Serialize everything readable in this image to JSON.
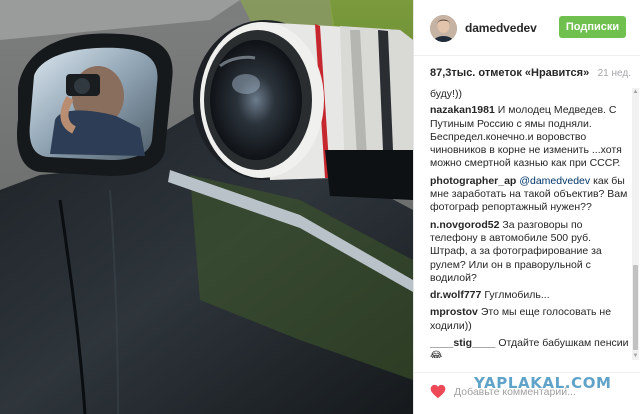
{
  "post": {
    "username": "damedvedev",
    "follow_label": "Подписки",
    "likes_text": "87,3тыс. отметок «Нравится»",
    "time_ago": "21 нед.",
    "comments": [
      {
        "author": "",
        "text": "буду!))"
      },
      {
        "author": "nazakan1981",
        "text": "И молодец Медведев. С Путиным Россию с ямы подняли. Беспредел.конечно.и воровство чиновников в корне не изменить ...хотя можно смертной казнью как при СССР."
      },
      {
        "author": "photographer_ap",
        "mention": "@damedvedev",
        "text": "как бы мне заработать на такой объектив? Вам фотограф репортажный нужен??"
      },
      {
        "author": "n.novgorod52",
        "text": "За разговоры по телефону в автомобиле 500 руб. Штраф, а за фотографирование за рулем? Или он в праворульной с водилой?"
      },
      {
        "author": "dr.wolf777",
        "text": "Гуглмобиль..."
      },
      {
        "author": "mprostov",
        "text": "Это мы еще голосовать не ходили))"
      },
      {
        "author": "____stig____",
        "text": "Отдайте бабушкам пенсии 😂"
      }
    ],
    "comment_placeholder": "Добавьте комментарий..."
  },
  "watermark": "YAPLAKAL.COM",
  "icons": {
    "like": "heart-icon",
    "scroll_up": "arrow-up-icon",
    "scroll_down": "arrow-down-icon"
  },
  "colors": {
    "follow_button": "#70c050",
    "heart": "#ed4956",
    "mention": "#003569",
    "watermark": "#5fa3c9"
  }
}
